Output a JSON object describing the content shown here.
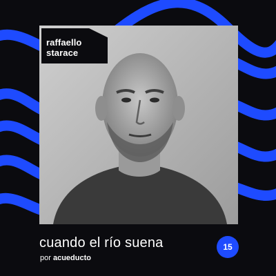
{
  "guest": {
    "line1": "raffaello",
    "line2": "starace"
  },
  "episode": {
    "title": "cuando el río suena",
    "by_prefix": "por",
    "by_brand": "acueducto",
    "number": "15"
  },
  "colors": {
    "background": "#0b0b0f",
    "accent": "#1e4bff",
    "text": "#ffffff"
  },
  "icons": {
    "background_art": "blue-wave-lines",
    "photo": "portrait-photo"
  }
}
